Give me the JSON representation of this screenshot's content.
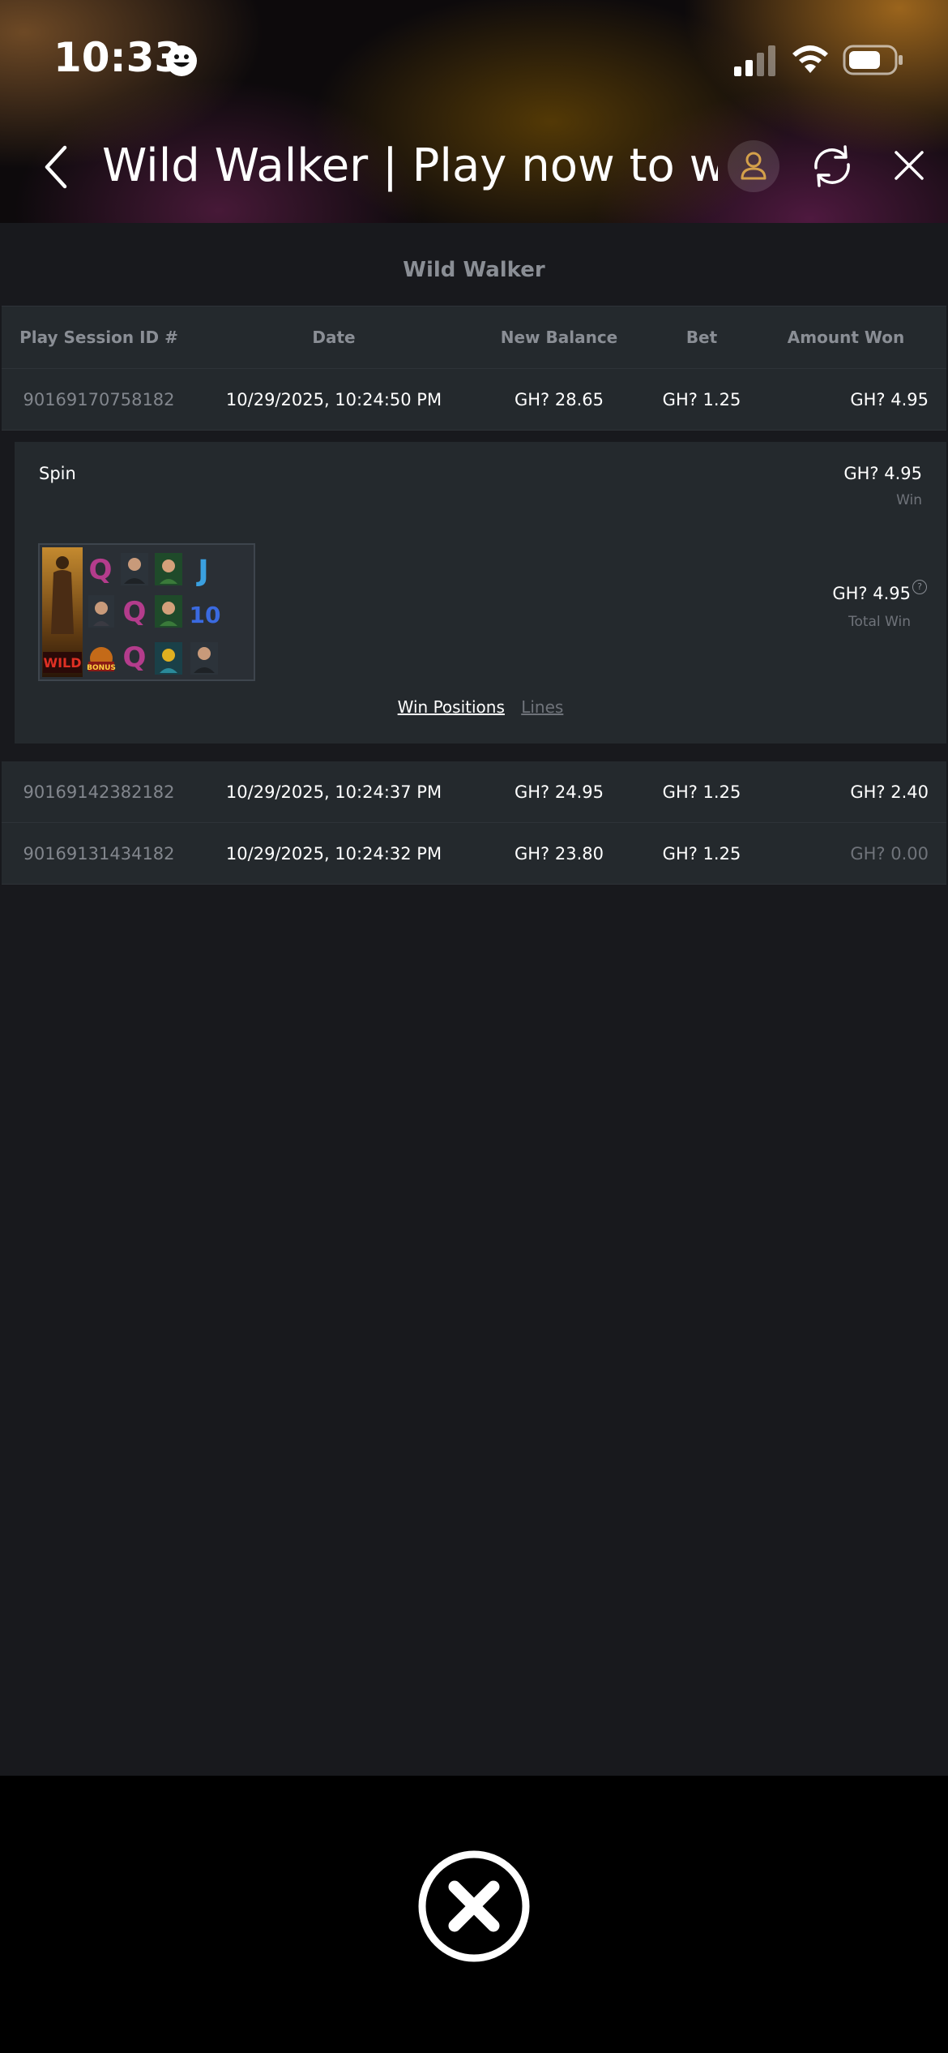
{
  "status_bar": {
    "time": "10:33"
  },
  "header": {
    "title": "Wild Walker | Play now to w..."
  },
  "history": {
    "game_title": "Wild Walker",
    "columns": [
      "Play Session ID #",
      "Date",
      "New Balance",
      "Bet",
      "Amount Won"
    ],
    "rows": [
      {
        "id": "90169170758182",
        "date": "10/29/2025, 10:24:50 PM",
        "balance": "GH? 28.65",
        "bet": "GH? 1.25",
        "won": "GH? 4.95"
      },
      {
        "id": "90169142382182",
        "date": "10/29/2025, 10:24:37 PM",
        "balance": "GH? 24.95",
        "bet": "GH? 1.25",
        "won": "GH? 2.40"
      },
      {
        "id": "90169131434182",
        "date": "10/29/2025, 10:24:32 PM",
        "balance": "GH? 23.80",
        "bet": "GH? 1.25",
        "won": "GH? 0.00"
      }
    ],
    "detail": {
      "spin_label": "Spin",
      "win_amount": "GH? 4.95",
      "win_label": "Win",
      "total_amount": "GH? 4.95",
      "total_label": "Total Win",
      "tab_win_positions": "Win Positions",
      "tab_lines": "Lines",
      "reel_symbols": [
        "WILD",
        "Q",
        "portrait",
        "portrait",
        "J",
        "Q",
        "portrait",
        "10",
        "BONUS",
        "Q",
        "portrait",
        "portrait"
      ]
    }
  },
  "colors": {
    "background": "#18191d",
    "row": "#24292d",
    "muted_text": "#8a8e95",
    "accent_gold": "#d4a04a"
  }
}
